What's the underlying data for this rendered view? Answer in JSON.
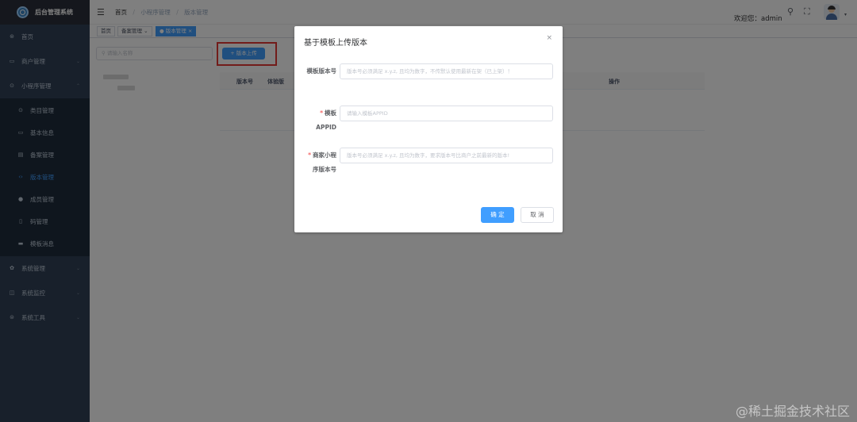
{
  "app": {
    "title": "后台管理系统"
  },
  "sidebar": {
    "items": [
      {
        "label": "首页",
        "icon": "dashboard-icon",
        "glyph": "⊛"
      },
      {
        "label": "商户管理",
        "icon": "shop-icon",
        "glyph": "▭",
        "arrow": "⌄"
      },
      {
        "label": "小程序管理",
        "icon": "miniprogram-icon",
        "glyph": "⊙",
        "arrow": "⌃"
      },
      {
        "label": "类目管理",
        "icon": "category-icon",
        "glyph": "⊙"
      },
      {
        "label": "基本信息",
        "icon": "info-icon",
        "glyph": "▭"
      },
      {
        "label": "备案管理",
        "icon": "record-icon",
        "glyph": "▤"
      },
      {
        "label": "版本管理",
        "icon": "version-icon",
        "glyph": "‹›"
      },
      {
        "label": "成员管理",
        "icon": "member-icon",
        "glyph": "●"
      },
      {
        "label": "码管理",
        "icon": "qrcode-icon",
        "glyph": "▯"
      },
      {
        "label": "模板消息",
        "icon": "template-message-icon",
        "glyph": "▬"
      },
      {
        "label": "系统管理",
        "icon": "settings-icon",
        "glyph": "✿",
        "arrow": "⌄"
      },
      {
        "label": "系统监控",
        "icon": "monitor-icon",
        "glyph": "◫",
        "arrow": "⌄"
      },
      {
        "label": "系统工具",
        "icon": "tool-icon",
        "glyph": "⊜",
        "arrow": "⌄"
      }
    ]
  },
  "navbar": {
    "hamburger": "☰",
    "breadcrumb": [
      "首页",
      "小程序管理",
      "版本管理"
    ],
    "breadcrumb_sep": "/",
    "welcome": "欢迎您：admin",
    "search_glyph": "⚲",
    "fullscreen_glyph": "⛶",
    "caret": "▾"
  },
  "tags": {
    "home": "首页",
    "filing": "备案管理",
    "filing_close": "⌄",
    "active": "● 版本管理",
    "active_close": "×"
  },
  "tree": {
    "search_placeholder": "请输入名称",
    "search_glyph": "⚲"
  },
  "main": {
    "upload_button": "+ 版本上传",
    "columns": [
      "版本号",
      "体验版",
      "操作"
    ]
  },
  "dialog": {
    "title": "基于模板上传版本",
    "close": "×",
    "fields": [
      {
        "label": "模板版本号",
        "required": false,
        "placeholder": "版本号必须满足 x.y.z, 且均为数字，不传默认使用最新在架（已上架）！"
      },
      {
        "label": "模板APPID",
        "required": true,
        "placeholder": "请输入模板APPID"
      },
      {
        "label": "商家小程序版本号",
        "required": true,
        "placeholder": "版本号必须满足 x.y.z, 且均为数字，要求版本号比商户之前最新的版本!"
      }
    ],
    "required_mark": "*",
    "confirm": "确 定",
    "cancel": "取 消"
  },
  "watermark": "@稀土掘金技术社区",
  "colors": {
    "sidebar": "#304156",
    "primary": "#409eff",
    "highlight": "#e53935",
    "required": "#f56c6c"
  }
}
